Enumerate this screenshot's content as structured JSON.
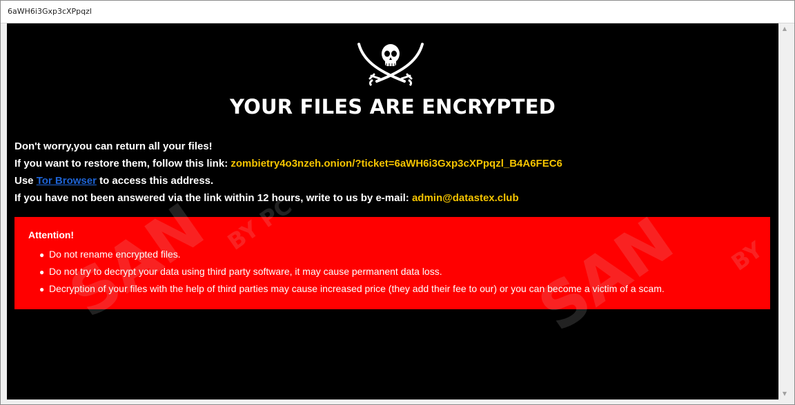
{
  "window": {
    "title": "6aWH6i3Gxp3cXPpqzl"
  },
  "content": {
    "headline": "YOUR FILES ARE ENCRYPTED",
    "line1": "Don't worry,you can return all your files!",
    "line2_prefix": "If you want to restore them, follow this link: ",
    "line2_link": "zombietry4o3nzeh.onion/?ticket=6aWH6i3Gxp3cXPpqzl_B4A6FEC6",
    "line3_prefix": "Use ",
    "line3_link": "Tor Browser",
    "line3_suffix": " to access this address.",
    "line4_prefix": "If you have not been answered via the link within 12 hours, write to us by e-mail: ",
    "line4_email": "admin@datastex.club"
  },
  "attention": {
    "title": "Attention!",
    "items": [
      "Do not rename encrypted files.",
      "Do not try to decrypt your data using third party software, it may cause permanent data loss.",
      "Decryption of your files with the help of third parties may cause increased price (they add their fee to our) or you can become a victim of a scam."
    ]
  },
  "icons": {
    "logo": "skull-crossed-swords-icon",
    "scroll_up": "scroll-up-arrow-icon",
    "scroll_down": "scroll-down-arrow-icon"
  },
  "colors": {
    "background": "#000000",
    "highlight": "#f5c400",
    "link": "#1e64d6",
    "alert_bg": "#ff0000"
  }
}
